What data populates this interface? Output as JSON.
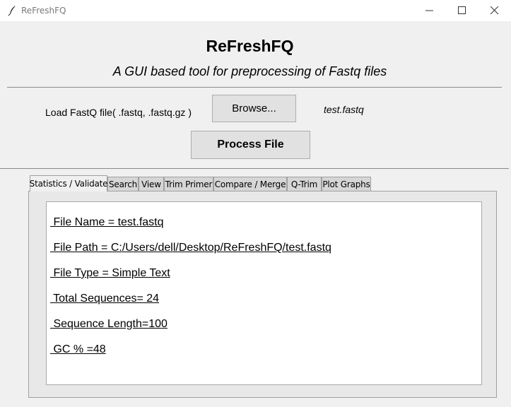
{
  "window": {
    "title": "ReFreshFQ",
    "icon": "feather-icon",
    "controls": [
      "minimize-icon",
      "maximize-icon",
      "close-icon"
    ]
  },
  "header": {
    "title": "ReFreshFQ",
    "subtitle": "A GUI based tool for preprocessing of Fastq files"
  },
  "load": {
    "label": "Load FastQ file( .fastq, .fastq.gz )",
    "browse_label": "Browse...",
    "selected_file": "test.fastq",
    "process_label": "Process File"
  },
  "tabs": [
    {
      "label": "Statistics / Validate",
      "active": true
    },
    {
      "label": "Search"
    },
    {
      "label": "View"
    },
    {
      "label": "Trim Primer"
    },
    {
      "label": "Compare / Merge"
    },
    {
      "label": "Q-Trim"
    },
    {
      "label": "Plot Graphs"
    }
  ],
  "stats": [
    " File Name = test.fastq",
    " File Path = C:/Users/dell/Desktop/ReFreshFQ/test.fastq",
    " File Type = Simple Text",
    " Total Sequences= 24",
    " Sequence Length=100",
    " GC % =48"
  ]
}
